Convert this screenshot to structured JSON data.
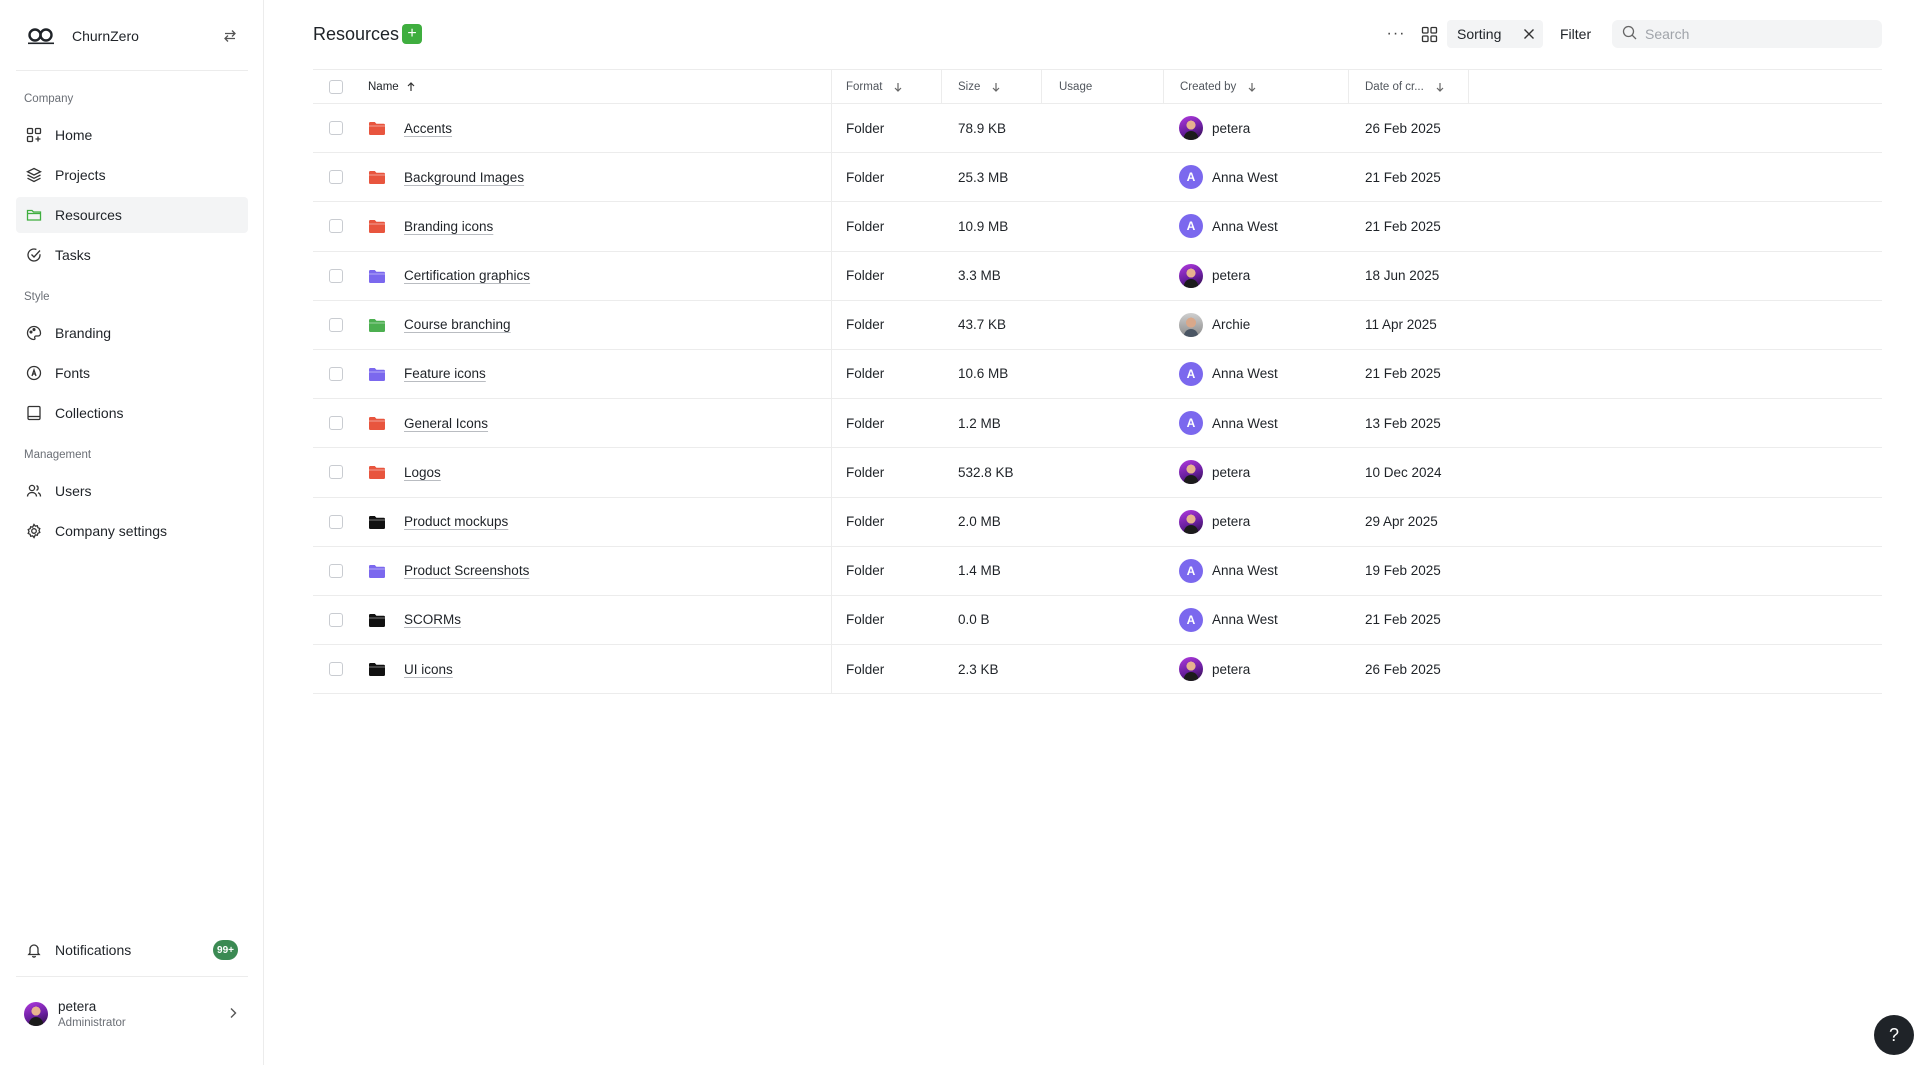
{
  "app": {
    "name": "ChurnZero"
  },
  "sidebar": {
    "sections": [
      {
        "label": "Company"
      },
      {
        "label": "Style"
      },
      {
        "label": "Management"
      }
    ],
    "items": [
      {
        "label": "Home",
        "icon": "grid-home-icon"
      },
      {
        "label": "Projects",
        "icon": "layers-icon"
      },
      {
        "label": "Resources",
        "icon": "folder-icon",
        "active": true
      },
      {
        "label": "Tasks",
        "icon": "check-circle-icon"
      },
      {
        "label": "Branding",
        "icon": "palette-icon"
      },
      {
        "label": "Fonts",
        "icon": "font-icon"
      },
      {
        "label": "Collections",
        "icon": "book-icon"
      },
      {
        "label": "Users",
        "icon": "users-icon"
      },
      {
        "label": "Company settings",
        "icon": "gear-icon"
      }
    ],
    "notifications": {
      "label": "Notifications",
      "badge": "99+"
    },
    "user": {
      "name": "petera",
      "role": "Administrator"
    }
  },
  "header": {
    "title": "Resources",
    "add_label": "+",
    "more_label": "···",
    "sorting_label": "Sorting",
    "filter_label": "Filter",
    "search_placeholder": "Search"
  },
  "table": {
    "columns": [
      {
        "label": "Name"
      },
      {
        "label": "Format"
      },
      {
        "label": "Size"
      },
      {
        "label": "Usage"
      },
      {
        "label": "Created by"
      },
      {
        "label": "Date of cr..."
      }
    ],
    "rows": [
      {
        "name": "Accents",
        "format": "Folder",
        "size": "78.9 KB",
        "usage": "",
        "created_by": "petera",
        "avatar": "photo",
        "date": "26 Feb 2025",
        "folder_color": "#e8553e"
      },
      {
        "name": "Background Images",
        "format": "Folder",
        "size": "25.3 MB",
        "usage": "",
        "created_by": "Anna West",
        "avatar": "A",
        "date": "21 Feb 2025",
        "folder_color": "#e8553e"
      },
      {
        "name": "Branding icons",
        "format": "Folder",
        "size": "10.9 MB",
        "usage": "",
        "created_by": "Anna West",
        "avatar": "A",
        "date": "21 Feb 2025",
        "folder_color": "#e8553e"
      },
      {
        "name": "Certification graphics",
        "format": "Folder",
        "size": "3.3 MB",
        "usage": "",
        "created_by": "petera",
        "avatar": "photo",
        "date": "18 Jun 2025",
        "folder_color": "#7b68ee"
      },
      {
        "name": "Course branching",
        "format": "Folder",
        "size": "43.7 KB",
        "usage": "",
        "created_by": "Archie",
        "avatar": "archie",
        "date": "11 Apr 2025",
        "folder_color": "#4caf50"
      },
      {
        "name": "Feature icons",
        "format": "Folder",
        "size": "10.6 MB",
        "usage": "",
        "created_by": "Anna West",
        "avatar": "A",
        "date": "21 Feb 2025",
        "folder_color": "#7b68ee"
      },
      {
        "name": "General Icons",
        "format": "Folder",
        "size": "1.2 MB",
        "usage": "",
        "created_by": "Anna West",
        "avatar": "A",
        "date": "13 Feb 2025",
        "folder_color": "#e8553e"
      },
      {
        "name": "Logos",
        "format": "Folder",
        "size": "532.8 KB",
        "usage": "",
        "created_by": "petera",
        "avatar": "photo",
        "date": "10 Dec 2024",
        "folder_color": "#e8553e"
      },
      {
        "name": "Product mockups",
        "format": "Folder",
        "size": "2.0 MB",
        "usage": "",
        "created_by": "petera",
        "avatar": "photo",
        "date": "29 Apr 2025",
        "folder_color": "#111111"
      },
      {
        "name": "Product Screenshots",
        "format": "Folder",
        "size": "1.4 MB",
        "usage": "",
        "created_by": "Anna West",
        "avatar": "A",
        "date": "19 Feb 2025",
        "folder_color": "#7b68ee"
      },
      {
        "name": "SCORMs",
        "format": "Folder",
        "size": "0.0 B",
        "usage": "",
        "created_by": "Anna West",
        "avatar": "A",
        "date": "21 Feb 2025",
        "folder_color": "#111111"
      },
      {
        "name": "UI icons",
        "format": "Folder",
        "size": "2.3 KB",
        "usage": "",
        "created_by": "petera",
        "avatar": "photo",
        "date": "26 Feb 2025",
        "folder_color": "#111111"
      }
    ]
  },
  "help": {
    "label": "?"
  },
  "colors": {
    "accent": "#3fae3f",
    "badge": "#3b8a53",
    "letter_avatar": "#7b68ee"
  }
}
